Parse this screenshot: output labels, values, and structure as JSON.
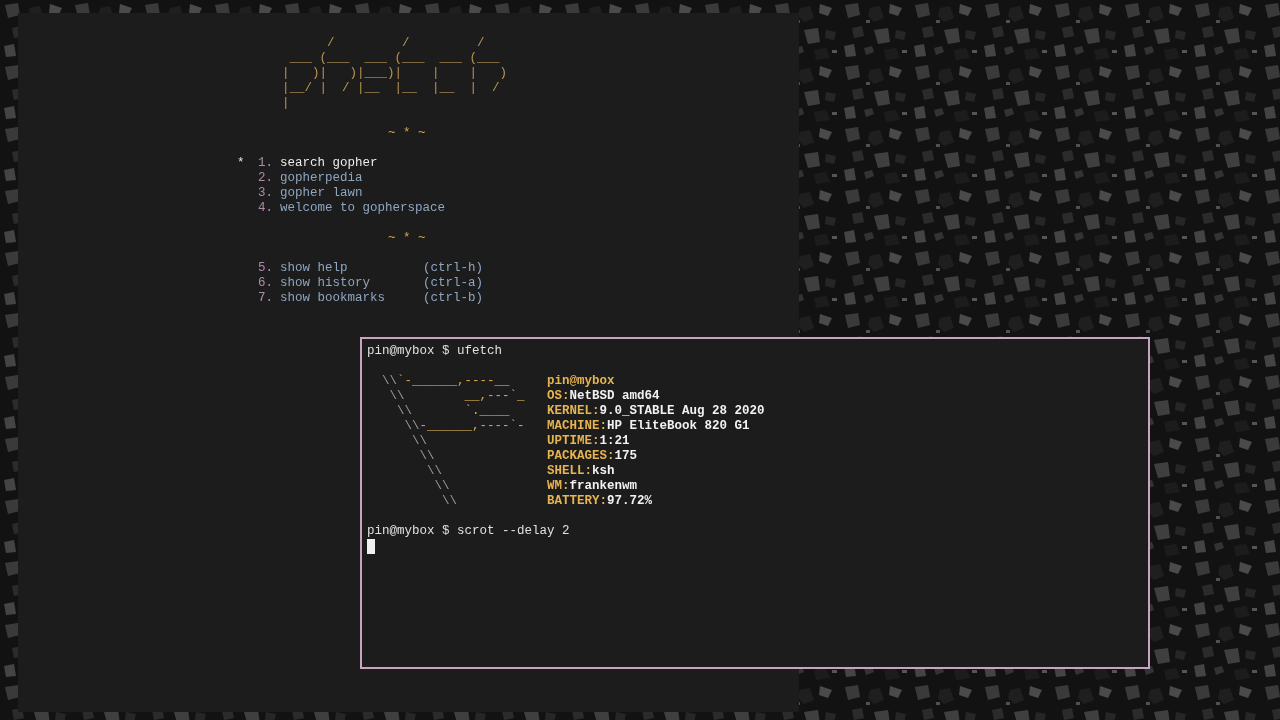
{
  "browser": {
    "logo": [
      "      /         /         /",
      " ___ (___  ___ (___  ___ (___",
      "|   )|   )|___)|    |    |   )",
      "|__/ |  / |__  |__  |__  |  /",
      "|"
    ],
    "cursor_marker": "*",
    "groups": [
      {
        "divider": "~ * ~",
        "items": [
          {
            "number": "1.",
            "label": "search gopher",
            "selected": true
          },
          {
            "number": "2.",
            "label": "gopherpedia",
            "selected": false
          },
          {
            "number": "3.",
            "label": "gopher lawn",
            "selected": false
          },
          {
            "number": "4.",
            "label": "welcome to gopherspace",
            "selected": false
          }
        ]
      },
      {
        "divider": "~ * ~",
        "items": [
          {
            "number": "5.",
            "label": "show help",
            "shortcut": "(ctrl-h)",
            "selected": false
          },
          {
            "number": "6.",
            "label": "show history",
            "shortcut": "(ctrl-a)",
            "selected": false
          },
          {
            "number": "7.",
            "label": "show bookmarks",
            "shortcut": "(ctrl-b)",
            "selected": false
          }
        ]
      }
    ]
  },
  "terminal": {
    "blocks": [
      {
        "kind": "command",
        "prompt": "pin@mybox $",
        "command": "ufetch"
      },
      {
        "kind": "fetch",
        "art": [
          {
            "pole": "  \\\\",
            "flag": "`-______,----__"
          },
          {
            "pole": "   \\\\",
            "flag": "        __,---`_"
          },
          {
            "pole": "    \\\\",
            "flag": "       `.____"
          },
          {
            "pole": "     \\\\",
            "flag": "-______,----`-"
          },
          {
            "pole": "      \\\\"
          },
          {
            "pole": "       \\\\"
          },
          {
            "pole": "        \\\\"
          },
          {
            "pole": "         \\\\"
          },
          {
            "pole": "          \\\\"
          }
        ],
        "info": [
          {
            "label": "pin@mybox"
          },
          {
            "label": "OS:",
            "value": "NetBSD amd64"
          },
          {
            "label": "KERNEL:",
            "value": "9.0_STABLE Aug 28 2020"
          },
          {
            "label": "MACHINE:",
            "value": "HP EliteBook 820 G1"
          },
          {
            "label": "UPTIME:",
            "value": "1:21"
          },
          {
            "label": "PACKAGES:",
            "value": "175"
          },
          {
            "label": "SHELL:",
            "value": "ksh"
          },
          {
            "label": "WM:",
            "value": "frankenwm"
          },
          {
            "label": "BATTERY:",
            "value": "97.72%"
          }
        ]
      },
      {
        "kind": "command",
        "prompt": "pin@mybox $",
        "command": "scrot --delay 2"
      },
      {
        "kind": "cursor"
      }
    ]
  }
}
